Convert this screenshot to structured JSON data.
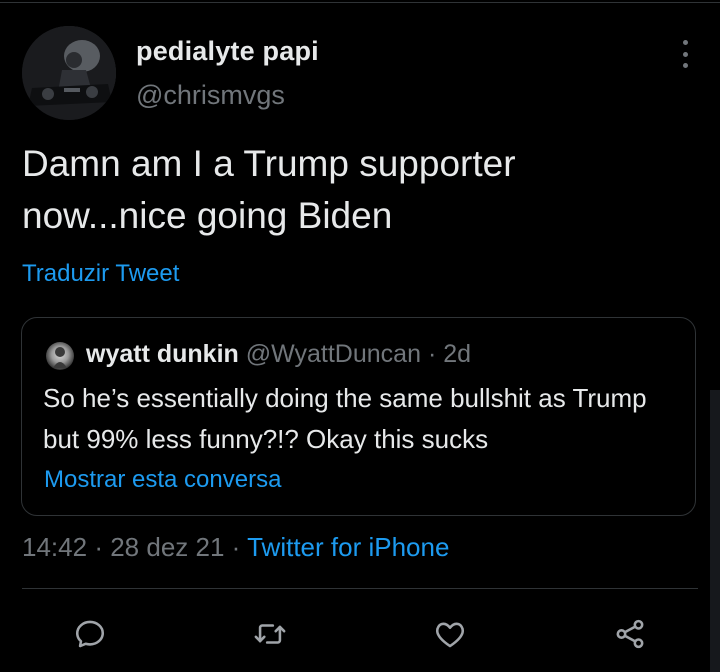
{
  "tweet": {
    "author": {
      "display_name": "pedialyte papi",
      "handle": "@chrismvgs"
    },
    "text": "Damn am I a Trump supporter now...nice going Biden",
    "translate_label": "Traduzir Tweet",
    "quoted": {
      "display_name": "wyatt dunkin",
      "handle": "@WyattDuncan",
      "separator": "·",
      "age": "2d",
      "text": "So he’s essentially doing the same bullshit as Trump but 99% less funny?!? Okay this sucks",
      "show_conversation_label": "Mostrar esta conversa"
    },
    "meta": {
      "time": "14:42",
      "separator": "·",
      "date": "28 dez 21",
      "source": "Twitter for iPhone"
    }
  },
  "actions": {
    "reply_icon": "reply-icon",
    "retweet_icon": "retweet-icon",
    "like_icon": "heart-icon",
    "share_icon": "share-icon"
  },
  "colors": {
    "background": "#000000",
    "text_primary": "#e7e9ea",
    "text_secondary": "#71767b",
    "link": "#1d9bf0",
    "border": "#2f3336"
  }
}
